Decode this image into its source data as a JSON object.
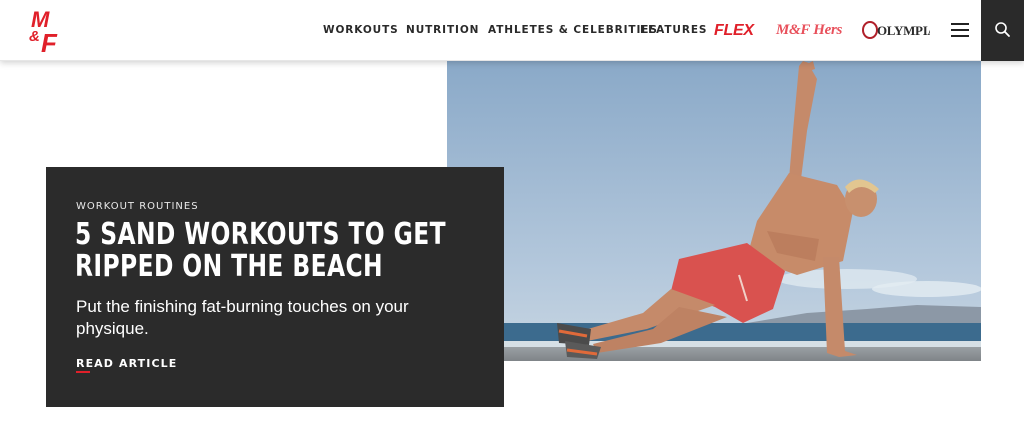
{
  "header": {
    "logo_text": "M&F",
    "nav": [
      "WORKOUTS",
      "NUTRITION",
      "ATHLETES & CELEBRITIES",
      "FEATURES"
    ],
    "brands": {
      "flex": "FLEX",
      "mfhers": "M&F Hers",
      "olympia": "OLYMPIA"
    },
    "menu_icon": "hamburger-icon",
    "search_icon": "search-icon"
  },
  "hero": {
    "image_subject": "man-side-plank-beach",
    "kicker": "WORKOUT ROUTINES",
    "headline": "5 SAND WORKOUTS TO GET RIPPED ON THE BEACH",
    "dek": "Put the finishing fat-burning touches on your physique.",
    "cta": "READ ARTICLE"
  },
  "colors": {
    "accent": "#e0202a",
    "card": "#2b2b2b",
    "search_bg": "#2a2a2a"
  }
}
